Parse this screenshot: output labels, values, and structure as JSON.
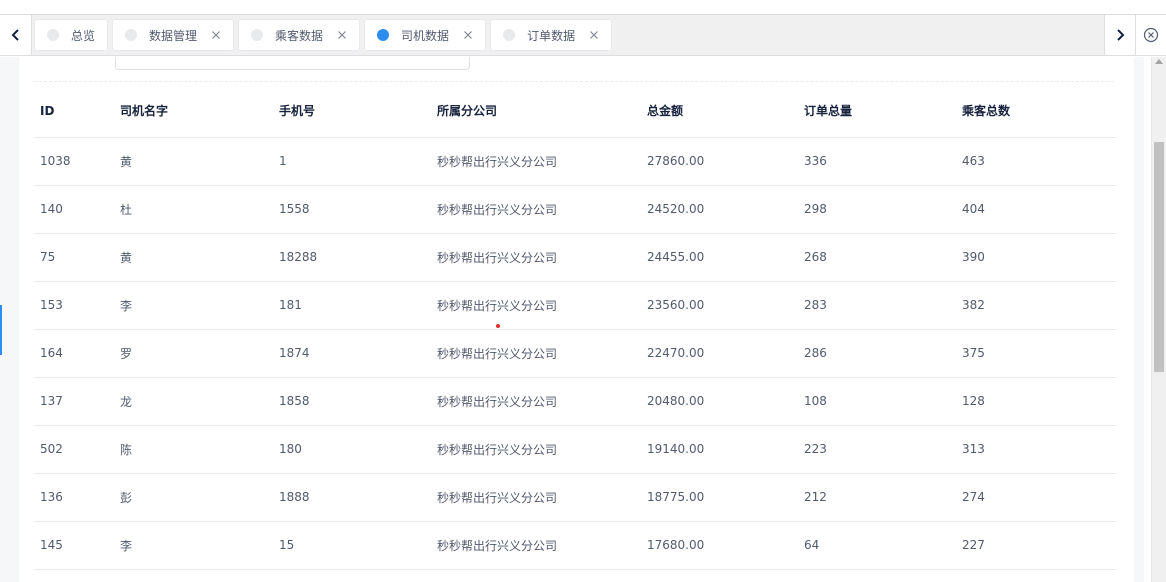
{
  "tabs": [
    {
      "label": "总览",
      "active": false,
      "closable": false
    },
    {
      "label": "数据管理",
      "active": false,
      "closable": true
    },
    {
      "label": "乘客数据",
      "active": false,
      "closable": true
    },
    {
      "label": "司机数据",
      "active": true,
      "closable": true
    },
    {
      "label": "订单数据",
      "active": false,
      "closable": true
    }
  ],
  "icons": {
    "scroll_left": "chevron-left-icon",
    "scroll_right": "chevron-right-icon",
    "close_all": "circle-close-icon",
    "tab_close": "close-icon"
  },
  "colors": {
    "accent": "#2d8cf0",
    "text": "#515a6e",
    "header_text": "#17233d",
    "border": "#e8eaec"
  },
  "table": {
    "columns": [
      "ID",
      "司机名字",
      "手机号",
      "所属分公司",
      "总金额",
      "订单总量",
      "乘客总数"
    ],
    "rows": [
      [
        "1038",
        "黄",
        "1",
        "秒秒帮出行兴义分公司",
        "27860.00",
        "336",
        "463"
      ],
      [
        "140",
        "杜",
        "1558",
        "秒秒帮出行兴义分公司",
        "24520.00",
        "298",
        "404"
      ],
      [
        "75",
        "黄",
        "18288",
        "秒秒帮出行兴义分公司",
        "24455.00",
        "268",
        "390"
      ],
      [
        "153",
        "李",
        "181",
        "秒秒帮出行兴义分公司",
        "23560.00",
        "283",
        "382"
      ],
      [
        "164",
        "罗",
        "1874",
        "秒秒帮出行兴义分公司",
        "22470.00",
        "286",
        "375"
      ],
      [
        "137",
        "龙",
        "1858",
        "秒秒帮出行兴义分公司",
        "20480.00",
        "108",
        "128"
      ],
      [
        "502",
        "陈",
        "180",
        "秒秒帮出行兴义分公司",
        "19140.00",
        "223",
        "313"
      ],
      [
        "136",
        "彭",
        "1888",
        "秒秒帮出行兴义分公司",
        "18775.00",
        "212",
        "274"
      ],
      [
        "145",
        "李",
        "15",
        "秒秒帮出行兴义分公司",
        "17680.00",
        "64",
        "227"
      ]
    ]
  }
}
